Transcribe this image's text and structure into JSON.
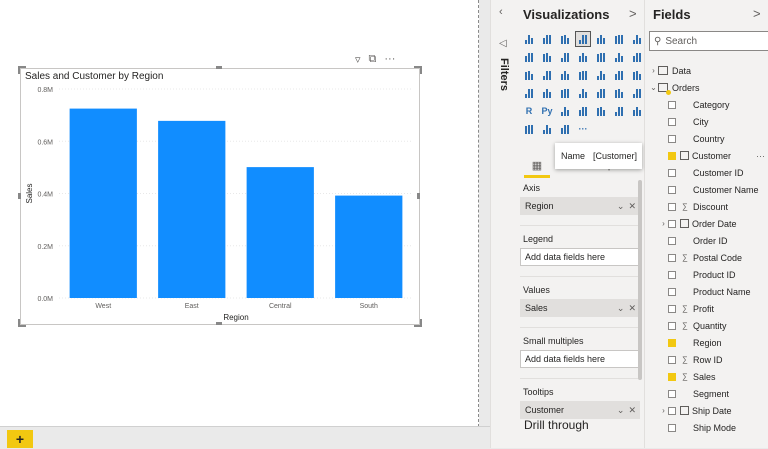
{
  "canvas": {
    "add_page": "+"
  },
  "visual": {
    "title": "Sales and Customer by Region",
    "header_icons": [
      "filter-icon",
      "focus-mode-icon",
      "more-options-icon"
    ]
  },
  "chart_data": {
    "type": "bar",
    "title": "Sales and Customer by Region",
    "xlabel": "Region",
    "ylabel": "Sales",
    "categories": [
      "West",
      "East",
      "Central",
      "South"
    ],
    "values": [
      725000,
      678000,
      501000,
      392000
    ],
    "ylim": [
      0,
      800000
    ],
    "yticks": [
      {
        "v": 0,
        "label": "0.0M"
      },
      {
        "v": 200000,
        "label": "0.2M"
      },
      {
        "v": 400000,
        "label": "0.4M"
      },
      {
        "v": 600000,
        "label": "0.6M"
      },
      {
        "v": 800000,
        "label": "0.8M"
      }
    ],
    "bar_color": "#118DFF",
    "grid": true
  },
  "filters": {
    "label": "Filters",
    "collapse_icon": "chevron-left-icon"
  },
  "visualizations": {
    "title": "Visualizations",
    "chevron": ">",
    "icons": [
      "stacked-bar-icon",
      "stacked-column-icon",
      "clustered-bar-icon",
      "clustered-column-icon",
      "100-bar-icon",
      "100-column-icon",
      "line-chart-icon",
      "area-chart-icon",
      "stacked-area-icon",
      "line-column-icon",
      "line-clustered-icon",
      "ribbon-icon",
      "waterfall-icon",
      "funnel-icon",
      "scatter-icon",
      "pie-icon",
      "donut-icon",
      "treemap-icon",
      "map-icon",
      "filled-map-icon",
      "shape-map-icon",
      "gauge-icon",
      "card-icon",
      "multi-row-card-icon",
      "kpi-icon",
      "slicer-icon",
      "table-icon",
      "matrix-icon",
      "r-visual-icon",
      "python-visual-icon",
      "key-influencers-icon",
      "decomposition-tree-icon",
      "qa-icon",
      "smart-narrative-icon",
      "paginated-report-icon",
      "power-apps-icon",
      "power-automate-icon",
      "diamond-icon",
      "more-visuals-icon"
    ],
    "icon_text": {
      "r-visual-icon": "R",
      "python-visual-icon": "Py",
      "more-visuals-icon": "···"
    },
    "selected_icon": "clustered-column-icon",
    "subtabs": [
      "fields-tab-icon",
      "format-tab-icon",
      "analytics-tab-icon"
    ],
    "wells": [
      {
        "label": "Axis",
        "value": "Region",
        "filled": true
      },
      {
        "label": "Legend",
        "value": "Add data fields here",
        "filled": false
      },
      {
        "label": "Values",
        "value": "Sales",
        "filled": true
      },
      {
        "label": "Small multiples",
        "value": "Add data fields here",
        "filled": false
      },
      {
        "label": "Tooltips",
        "value": "Customer",
        "filled": true
      }
    ],
    "drill_through": "Drill through",
    "tooltip": {
      "key": "Name",
      "value": "[Customer]"
    }
  },
  "fields": {
    "title": "Fields",
    "chevron": ">",
    "search_placeholder": "Search",
    "tables": [
      {
        "name": "Data",
        "expanded": false
      },
      {
        "name": "Orders",
        "expanded": true
      }
    ],
    "orders_fields": [
      {
        "name": "Category",
        "type": "text",
        "checked": false
      },
      {
        "name": "City",
        "type": "text",
        "checked": false
      },
      {
        "name": "Country",
        "type": "text",
        "checked": false
      },
      {
        "name": "Customer",
        "type": "calc",
        "checked": true,
        "more": "···"
      },
      {
        "name": "Customer ID",
        "type": "text",
        "checked": false
      },
      {
        "name": "Customer Name",
        "type": "text",
        "checked": false
      },
      {
        "name": "Discount",
        "type": "sum",
        "checked": false
      },
      {
        "name": "Order Date",
        "type": "date",
        "checked": false,
        "expandable": true
      },
      {
        "name": "Order ID",
        "type": "text",
        "checked": false
      },
      {
        "name": "Postal Code",
        "type": "sum",
        "checked": false
      },
      {
        "name": "Product ID",
        "type": "text",
        "checked": false
      },
      {
        "name": "Product Name",
        "type": "text",
        "checked": false
      },
      {
        "name": "Profit",
        "type": "sum",
        "checked": false
      },
      {
        "name": "Quantity",
        "type": "sum",
        "checked": false
      },
      {
        "name": "Region",
        "type": "text",
        "checked": true
      },
      {
        "name": "Row ID",
        "type": "sum",
        "checked": false
      },
      {
        "name": "Sales",
        "type": "sum",
        "checked": true
      },
      {
        "name": "Segment",
        "type": "text",
        "checked": false
      },
      {
        "name": "Ship Date",
        "type": "date",
        "checked": false,
        "expandable": true
      },
      {
        "name": "Ship Mode",
        "type": "text",
        "checked": false
      }
    ]
  }
}
